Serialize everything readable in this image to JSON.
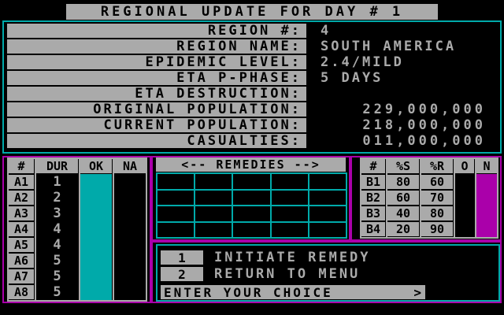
{
  "title": "REGIONAL UPDATE FOR DAY # 1",
  "colors": {
    "cyan": "#00aaaa",
    "magenta": "#aa00aa",
    "gray": "#aaaaaa",
    "black": "#000000"
  },
  "info": [
    {
      "label": "REGION #:",
      "value": "4",
      "align": "left"
    },
    {
      "label": "REGION NAME:",
      "value": "SOUTH AMERICA",
      "align": "left"
    },
    {
      "label": "EPIDEMIC LEVEL:",
      "value": "2.4/MILD",
      "align": "left"
    },
    {
      "label": "ETA P-PHASE:",
      "value": "5 DAYS",
      "align": "left"
    },
    {
      "label": "ETA DESTRUCTION:",
      "value": "",
      "align": "left"
    },
    {
      "label": "ORIGINAL POPULATION:",
      "value": "229,000,000",
      "align": "right"
    },
    {
      "label": "CURRENT POPULATION:",
      "value": "218,000,000",
      "align": "right"
    },
    {
      "label": "CASUALTIES:",
      "value": "011,000,000",
      "align": "right"
    }
  ],
  "agents": {
    "headers": [
      "#",
      "DUR",
      "OK",
      "NA"
    ],
    "rows": [
      {
        "id": "A1",
        "dur": "1"
      },
      {
        "id": "A2",
        "dur": "2"
      },
      {
        "id": "A3",
        "dur": "3"
      },
      {
        "id": "A4",
        "dur": "4"
      },
      {
        "id": "A5",
        "dur": "4"
      },
      {
        "id": "A6",
        "dur": "5"
      },
      {
        "id": "A7",
        "dur": "5"
      },
      {
        "id": "A8",
        "dur": "5"
      }
    ]
  },
  "remedies": {
    "title": "<-- REMEDIES -->"
  },
  "b_table": {
    "headers": [
      "#",
      "%S",
      "%R",
      "O",
      "N"
    ],
    "rows": [
      {
        "id": "B1",
        "s": "80",
        "r": "60"
      },
      {
        "id": "B2",
        "s": "60",
        "r": "70"
      },
      {
        "id": "B3",
        "s": "40",
        "r": "80"
      },
      {
        "id": "B4",
        "s": "20",
        "r": "90"
      }
    ]
  },
  "menu": {
    "options": [
      {
        "key": "1",
        "label": "INITIATE REMEDY"
      },
      {
        "key": "2",
        "label": "RETURN TO MENU"
      }
    ],
    "prompt": "ENTER YOUR CHOICE",
    "cursor": ">"
  }
}
